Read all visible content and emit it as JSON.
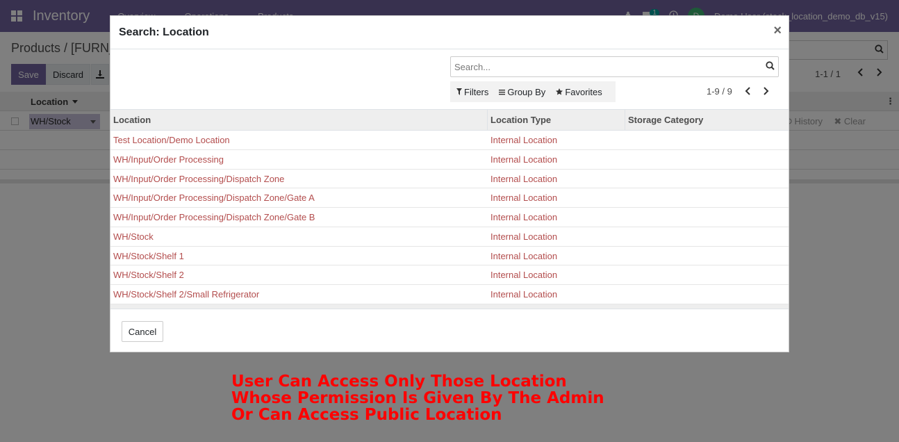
{
  "app": {
    "name": "Inventory",
    "menu": [
      "Overview",
      "Operations",
      "Products"
    ],
    "badge_count": "1",
    "avatar_letter": "D",
    "user": "Demo User (stock_location_demo_db_v15)"
  },
  "background": {
    "breadcrumb": "Products / [FURN_",
    "save_label": "Save",
    "discard_label": "Discard",
    "pager": "1-1 / 1",
    "column_location": "Location",
    "row_location_value": "WH/Stock",
    "history_label": "History",
    "clear_label": "Clear"
  },
  "modal": {
    "title": "Search: Location",
    "close_glyph": "×",
    "search_placeholder": "Search...",
    "filters_label": "Filters",
    "groupby_label": "Group By",
    "favorites_label": "Favorites",
    "pager": "1-9 / 9",
    "columns": [
      "Location",
      "Location Type",
      "Storage Category"
    ],
    "rows": [
      {
        "location": "Test Location/Demo Location",
        "type": "Internal Location",
        "category": ""
      },
      {
        "location": "WH/Input/Order Processing",
        "type": "Internal Location",
        "category": ""
      },
      {
        "location": "WH/Input/Order Processing/Dispatch Zone",
        "type": "Internal Location",
        "category": ""
      },
      {
        "location": "WH/Input/Order Processing/Dispatch Zone/Gate A",
        "type": "Internal Location",
        "category": ""
      },
      {
        "location": "WH/Input/Order Processing/Dispatch Zone/Gate B",
        "type": "Internal Location",
        "category": ""
      },
      {
        "location": "WH/Stock",
        "type": "Internal Location",
        "category": ""
      },
      {
        "location": "WH/Stock/Shelf 1",
        "type": "Internal Location",
        "category": ""
      },
      {
        "location": "WH/Stock/Shelf 2",
        "type": "Internal Location",
        "category": ""
      },
      {
        "location": "WH/Stock/Shelf 2/Small Refrigerator",
        "type": "Internal Location",
        "category": ""
      }
    ],
    "cancel_label": "Cancel"
  },
  "annotation": {
    "lines": [
      "User Can Access Only Those Location",
      "Whose Permission Is Given By The Admin",
      "Or Can Access Public Location"
    ]
  },
  "colors": {
    "brand": "#71639e",
    "link": "#b34d4d",
    "annotation": "#ff0000"
  }
}
